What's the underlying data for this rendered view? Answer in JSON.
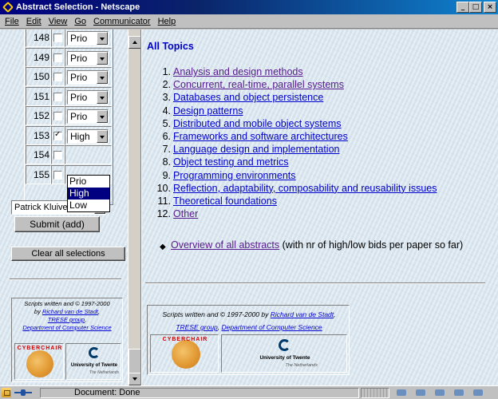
{
  "window": {
    "title": "Abstract Selection - Netscape",
    "controls": [
      "_",
      "□",
      "×"
    ]
  },
  "menu": [
    "File",
    "Edit",
    "View",
    "Go",
    "Communicator",
    "Help"
  ],
  "papers": [
    {
      "number": "148",
      "checked": false,
      "priority": "Prio"
    },
    {
      "number": "149",
      "checked": false,
      "priority": "Prio"
    },
    {
      "number": "150",
      "checked": false,
      "priority": "Prio"
    },
    {
      "number": "151",
      "checked": false,
      "priority": "Prio"
    },
    {
      "number": "152",
      "checked": false,
      "priority": "Prio"
    },
    {
      "number": "153",
      "checked": true,
      "priority": "High"
    },
    {
      "number": "154",
      "checked": false,
      "priority": ""
    },
    {
      "number": "155",
      "checked": false,
      "priority": ""
    }
  ],
  "priority_dropdown": {
    "options": [
      "Prio",
      "High",
      "Low"
    ],
    "highlighted": "High"
  },
  "reviewer": {
    "selected": "Patrick Kluivert"
  },
  "buttons": {
    "submit": "Submit (add)",
    "clear": "Clear all selections"
  },
  "credits_left": {
    "line1": "Scripts written and © 1997-2000",
    "line2_prefix": "by ",
    "author": "Richard van de Stadt",
    "line2_suffix": ",",
    "group": "TRESE group",
    "sep": ", ",
    "dept": "Department of Computer Science",
    "cyberchair": "CYBERCHAIR",
    "university": "University of Twente",
    "country": "The Netherlands"
  },
  "credits_right": {
    "line1_prefix": "Scripts written and © 1997-2000 by ",
    "author": "Richard van de Stadt",
    "line1_suffix": ",",
    "group": "TRESE group",
    "sep": ", ",
    "dept": "Department of Computer Science",
    "cyberchair": "CYBERCHAIR",
    "university": "University of Twente",
    "country": "The Netherlands"
  },
  "topics_heading": "All Topics",
  "topics": [
    {
      "n": "1.",
      "label": "Analysis and design methods",
      "visited": true
    },
    {
      "n": "2.",
      "label": "Concurrent, real-time, parallel systems",
      "visited": true
    },
    {
      "n": "3.",
      "label": "Databases and object persistence",
      "visited": false
    },
    {
      "n": "4.",
      "label": "Design patterns",
      "visited": false
    },
    {
      "n": "5.",
      "label": "Distributed and mobile object systems",
      "visited": false
    },
    {
      "n": "6.",
      "label": "Frameworks and software architectures",
      "visited": false
    },
    {
      "n": "7.",
      "label": "Language design and implementation",
      "visited": false
    },
    {
      "n": "8.",
      "label": "Object testing and metrics",
      "visited": false
    },
    {
      "n": "9.",
      "label": "Programming environments",
      "visited": false
    },
    {
      "n": "10.",
      "label": "Reflection, adaptability, composability and reusability issues",
      "visited": false
    },
    {
      "n": "11.",
      "label": "Theoretical foundations",
      "visited": false
    },
    {
      "n": "12.",
      "label": "Other",
      "visited": true
    }
  ],
  "overview": {
    "link": "Overview of all abstracts",
    "rest": " (with nr of high/low bids per paper so far)"
  },
  "status": {
    "text": "Document: Done"
  }
}
